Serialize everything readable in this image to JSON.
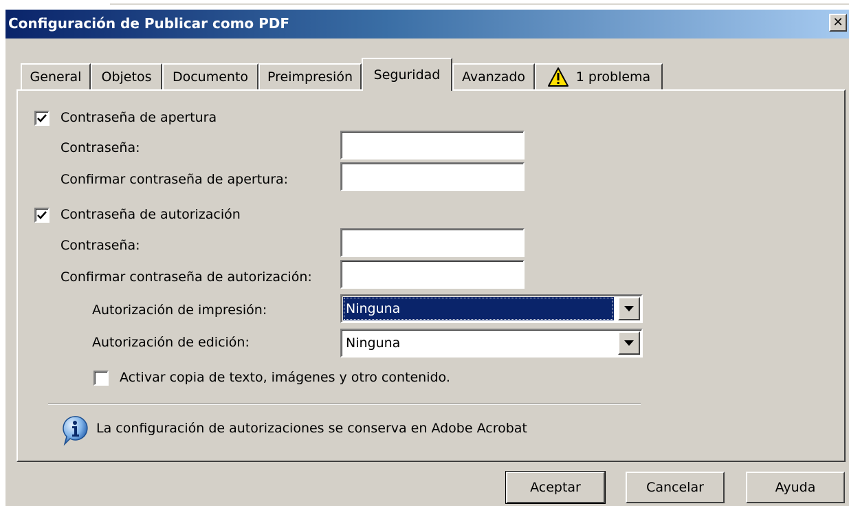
{
  "window": {
    "title": "Configuración de Publicar como PDF"
  },
  "tabs": [
    {
      "label": "General"
    },
    {
      "label": "Objetos"
    },
    {
      "label": "Documento"
    },
    {
      "label": "Preimpresión"
    },
    {
      "label": "Seguridad",
      "active": true
    },
    {
      "label": "Avanzado"
    },
    {
      "label": "1 problema",
      "icon": "warning-icon"
    }
  ],
  "security": {
    "open_password": {
      "checkbox_label": "Contraseña de apertura",
      "checked": true,
      "password_label": "Contraseña:",
      "password_value": "",
      "confirm_label": "Confirmar contraseña de apertura:",
      "confirm_value": ""
    },
    "permissions_password": {
      "checkbox_label": "Contraseña de autorización",
      "checked": true,
      "password_label": "Contraseña:",
      "password_value": "",
      "confirm_label": "Confirmar contraseña de autorización:",
      "confirm_value": "",
      "print_label": "Autorización de impresión:",
      "print_value": "Ninguna",
      "edit_label": "Autorización de edición:",
      "edit_value": "Ninguna",
      "copy_label": "Activar copia de texto, imágenes y otro contenido.",
      "copy_checked": false
    },
    "info": {
      "icon": "info-icon",
      "text": "La configuración de autorizaciones se conserva en Adobe Acrobat"
    }
  },
  "buttons": {
    "ok": "Aceptar",
    "cancel": "Cancelar",
    "help": "Ayuda"
  },
  "colors": {
    "titlebar_start": "#0a246a",
    "titlebar_end": "#a6caf0",
    "face": "#d4d0c8",
    "selection": "#0a246a"
  }
}
